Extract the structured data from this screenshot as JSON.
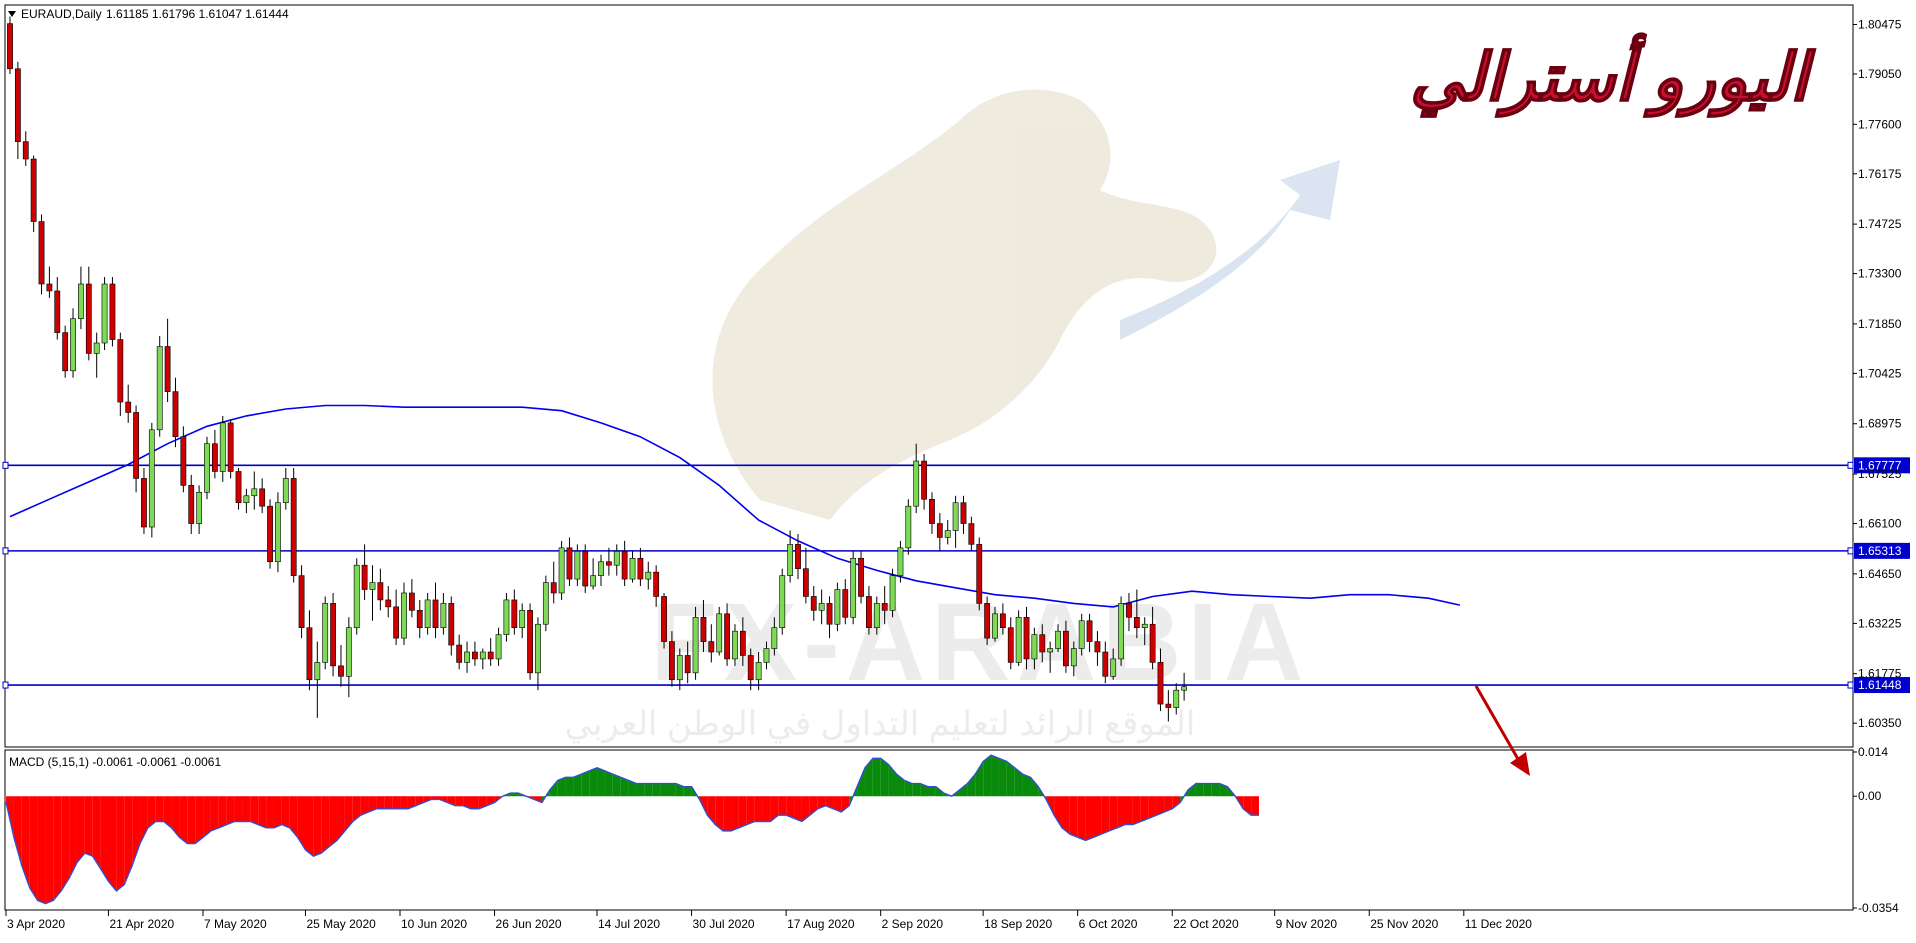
{
  "header": {
    "symbol": "EURAUD,Daily",
    "ohlc": "1.61185 1.61796 1.61047 1.61444"
  },
  "overlay_title": "اليورو أسترالي",
  "watermark": {
    "brand": "FX-ARABIA",
    "tagline": "الموقع الرائد لتعليم التداول في الوطن العربي"
  },
  "colors": {
    "bull_body": "#7ed957",
    "bear_body": "#cc0000",
    "wick": "#000000",
    "ma_line": "#0000ee",
    "level_line": "#0000cc",
    "macd_positive": "#0a8a0a",
    "macd_negative": "#ff0000",
    "macd_outline": "#3050d0",
    "arrow": "#c00000",
    "title_red": "#c8102e",
    "axis_text": "#000000"
  },
  "chart_data": [
    {
      "type": "candlestick",
      "symbol": "EURAUD",
      "timeframe": "Daily",
      "ylim": [
        1.5975,
        1.8095
      ],
      "y_ticks": [
        "1.80475",
        "1.79050",
        "1.77600",
        "1.76175",
        "1.74725",
        "1.73300",
        "1.71850",
        "1.70425",
        "1.68975",
        "1.67525",
        "1.66100",
        "1.64650",
        "1.63225",
        "1.61775",
        "1.60350"
      ],
      "x_ticks": [
        "3 Apr 2020",
        "21 Apr 2020",
        "7 May 2020",
        "25 May 2020",
        "10 Jun 2020",
        "26 Jun 2020",
        "14 Jul 2020",
        "30 Jul 2020",
        "17 Aug 2020",
        "2 Sep 2020",
        "18 Sep 2020",
        "6 Oct 2020",
        "22 Oct 2020",
        "9 Nov 2020",
        "25 Nov 2020",
        "11 Dec 2020"
      ],
      "x_tick_index": [
        0,
        13,
        25,
        38,
        50,
        62,
        75,
        87,
        99,
        111,
        124,
        136,
        148,
        161,
        173,
        185
      ],
      "horizontal_levels": [
        {
          "value": 1.67777,
          "label": "1.67777"
        },
        {
          "value": 1.65313,
          "label": "1.65313"
        },
        {
          "value": 1.61448,
          "label": "1.61448"
        }
      ],
      "ma_points": [
        [
          0,
          1.663
        ],
        [
          5,
          1.668
        ],
        [
          10,
          1.673
        ],
        [
          15,
          1.678
        ],
        [
          20,
          1.684
        ],
        [
          25,
          1.689
        ],
        [
          30,
          1.692
        ],
        [
          35,
          1.694
        ],
        [
          40,
          1.695
        ],
        [
          45,
          1.695
        ],
        [
          50,
          1.6945
        ],
        [
          55,
          1.6945
        ],
        [
          60,
          1.6945
        ],
        [
          65,
          1.6945
        ],
        [
          70,
          1.6935
        ],
        [
          75,
          1.69
        ],
        [
          80,
          1.686
        ],
        [
          85,
          1.68
        ],
        [
          90,
          1.672
        ],
        [
          95,
          1.662
        ],
        [
          100,
          1.656
        ],
        [
          105,
          1.651
        ],
        [
          110,
          1.6475
        ],
        [
          115,
          1.6445
        ],
        [
          120,
          1.6425
        ],
        [
          125,
          1.6405
        ],
        [
          130,
          1.6395
        ],
        [
          135,
          1.638
        ],
        [
          140,
          1.637
        ],
        [
          145,
          1.64
        ],
        [
          150,
          1.6415
        ],
        [
          155,
          1.6405
        ],
        [
          160,
          1.64
        ],
        [
          165,
          1.6395
        ],
        [
          170,
          1.6405
        ],
        [
          175,
          1.6405
        ],
        [
          180,
          1.6395
        ],
        [
          184,
          1.6375
        ]
      ],
      "candles_ohl_c": [
        [
          1.805,
          1.807,
          1.7905,
          1.792
        ],
        [
          1.792,
          1.794,
          1.766,
          1.771
        ],
        [
          1.771,
          1.774,
          1.764,
          1.766
        ],
        [
          1.766,
          1.767,
          1.745,
          1.748
        ],
        [
          1.748,
          1.75,
          1.727,
          1.73
        ],
        [
          1.73,
          1.735,
          1.726,
          1.728
        ],
        [
          1.728,
          1.732,
          1.714,
          1.716
        ],
        [
          1.716,
          1.718,
          1.703,
          1.705
        ],
        [
          1.705,
          1.723,
          1.703,
          1.72
        ],
        [
          1.72,
          1.735,
          1.717,
          1.73
        ],
        [
          1.73,
          1.735,
          1.708,
          1.71
        ],
        [
          1.71,
          1.716,
          1.703,
          1.713
        ],
        [
          1.713,
          1.732,
          1.711,
          1.73
        ],
        [
          1.73,
          1.732,
          1.712,
          1.714
        ],
        [
          1.714,
          1.716,
          1.692,
          1.696
        ],
        [
          1.696,
          1.701,
          1.69,
          1.693
        ],
        [
          1.693,
          1.695,
          1.67,
          1.674
        ],
        [
          1.674,
          1.677,
          1.658,
          1.66
        ],
        [
          1.66,
          1.69,
          1.657,
          1.688
        ],
        [
          1.688,
          1.715,
          1.686,
          1.712
        ],
        [
          1.712,
          1.72,
          1.696,
          1.699
        ],
        [
          1.699,
          1.703,
          1.683,
          1.686
        ],
        [
          1.686,
          1.689,
          1.67,
          1.672
        ],
        [
          1.672,
          1.675,
          1.658,
          1.661
        ],
        [
          1.661,
          1.672,
          1.658,
          1.67
        ],
        [
          1.67,
          1.686,
          1.668,
          1.684
        ],
        [
          1.684,
          1.688,
          1.674,
          1.676
        ],
        [
          1.676,
          1.692,
          1.673,
          1.69
        ],
        [
          1.69,
          1.691,
          1.674,
          1.676
        ],
        [
          1.676,
          1.677,
          1.665,
          1.667
        ],
        [
          1.667,
          1.671,
          1.664,
          1.669
        ],
        [
          1.669,
          1.676,
          1.665,
          1.671
        ],
        [
          1.671,
          1.674,
          1.664,
          1.666
        ],
        [
          1.666,
          1.668,
          1.648,
          1.65
        ],
        [
          1.65,
          1.67,
          1.647,
          1.667
        ],
        [
          1.667,
          1.677,
          1.665,
          1.674
        ],
        [
          1.674,
          1.677,
          1.644,
          1.646
        ],
        [
          1.646,
          1.649,
          1.628,
          1.631
        ],
        [
          1.631,
          1.636,
          1.613,
          1.616
        ],
        [
          1.616,
          1.627,
          1.605,
          1.621
        ],
        [
          1.621,
          1.64,
          1.619,
          1.638
        ],
        [
          1.638,
          1.641,
          1.617,
          1.62
        ],
        [
          1.62,
          1.626,
          1.614,
          1.617
        ],
        [
          1.617,
          1.634,
          1.611,
          1.631
        ],
        [
          1.631,
          1.651,
          1.629,
          1.649
        ],
        [
          1.649,
          1.655,
          1.639,
          1.642
        ],
        [
          1.642,
          1.649,
          1.633,
          1.644
        ],
        [
          1.644,
          1.648,
          1.636,
          1.639
        ],
        [
          1.639,
          1.643,
          1.634,
          1.637
        ],
        [
          1.637,
          1.642,
          1.626,
          1.628
        ],
        [
          1.628,
          1.644,
          1.626,
          1.641
        ],
        [
          1.641,
          1.645,
          1.634,
          1.636
        ],
        [
          1.636,
          1.639,
          1.628,
          1.631
        ],
        [
          1.631,
          1.641,
          1.629,
          1.639
        ],
        [
          1.639,
          1.644,
          1.628,
          1.631
        ],
        [
          1.631,
          1.641,
          1.629,
          1.638
        ],
        [
          1.638,
          1.64,
          1.623,
          1.626
        ],
        [
          1.626,
          1.629,
          1.619,
          1.621
        ],
        [
          1.621,
          1.627,
          1.618,
          1.624
        ],
        [
          1.624,
          1.627,
          1.62,
          1.622
        ],
        [
          1.622,
          1.625,
          1.619,
          1.624
        ],
        [
          1.624,
          1.628,
          1.62,
          1.622
        ],
        [
          1.622,
          1.631,
          1.62,
          1.629
        ],
        [
          1.629,
          1.641,
          1.627,
          1.639
        ],
        [
          1.639,
          1.642,
          1.629,
          1.631
        ],
        [
          1.631,
          1.638,
          1.628,
          1.636
        ],
        [
          1.636,
          1.638,
          1.616,
          1.618
        ],
        [
          1.618,
          1.634,
          1.613,
          1.632
        ],
        [
          1.632,
          1.646,
          1.63,
          1.644
        ],
        [
          1.644,
          1.65,
          1.638,
          1.641
        ],
        [
          1.641,
          1.656,
          1.639,
          1.654
        ],
        [
          1.654,
          1.657,
          1.643,
          1.645
        ],
        [
          1.645,
          1.655,
          1.643,
          1.653
        ],
        [
          1.653,
          1.655,
          1.641,
          1.643
        ],
        [
          1.643,
          1.651,
          1.642,
          1.646
        ],
        [
          1.646,
          1.652,
          1.643,
          1.65
        ],
        [
          1.65,
          1.654,
          1.646,
          1.649
        ],
        [
          1.649,
          1.655,
          1.646,
          1.653
        ],
        [
          1.653,
          1.656,
          1.643,
          1.645
        ],
        [
          1.645,
          1.653,
          1.644,
          1.651
        ],
        [
          1.651,
          1.654,
          1.643,
          1.645
        ],
        [
          1.645,
          1.65,
          1.642,
          1.647
        ],
        [
          1.647,
          1.649,
          1.637,
          1.64
        ],
        [
          1.64,
          1.641,
          1.625,
          1.627
        ],
        [
          1.627,
          1.63,
          1.614,
          1.616
        ],
        [
          1.616,
          1.625,
          1.613,
          1.623
        ],
        [
          1.623,
          1.627,
          1.615,
          1.618
        ],
        [
          1.618,
          1.637,
          1.616,
          1.634
        ],
        [
          1.634,
          1.639,
          1.624,
          1.627
        ],
        [
          1.627,
          1.632,
          1.621,
          1.624
        ],
        [
          1.624,
          1.637,
          1.623,
          1.635
        ],
        [
          1.635,
          1.638,
          1.62,
          1.622
        ],
        [
          1.622,
          1.632,
          1.62,
          1.63
        ],
        [
          1.63,
          1.634,
          1.62,
          1.623
        ],
        [
          1.623,
          1.625,
          1.613,
          1.616
        ],
        [
          1.616,
          1.624,
          1.613,
          1.621
        ],
        [
          1.621,
          1.627,
          1.619,
          1.625
        ],
        [
          1.625,
          1.634,
          1.623,
          1.631
        ],
        [
          1.631,
          1.648,
          1.629,
          1.646
        ],
        [
          1.646,
          1.659,
          1.644,
          1.655
        ],
        [
          1.655,
          1.658,
          1.645,
          1.648
        ],
        [
          1.648,
          1.654,
          1.638,
          1.64
        ],
        [
          1.64,
          1.643,
          1.633,
          1.636
        ],
        [
          1.636,
          1.642,
          1.632,
          1.638
        ],
        [
          1.638,
          1.64,
          1.628,
          1.632
        ],
        [
          1.632,
          1.644,
          1.63,
          1.642
        ],
        [
          1.642,
          1.645,
          1.632,
          1.634
        ],
        [
          1.634,
          1.653,
          1.632,
          1.651
        ],
        [
          1.651,
          1.653,
          1.638,
          1.64
        ],
        [
          1.64,
          1.643,
          1.629,
          1.631
        ],
        [
          1.631,
          1.64,
          1.629,
          1.638
        ],
        [
          1.638,
          1.643,
          1.632,
          1.636
        ],
        [
          1.636,
          1.648,
          1.634,
          1.646
        ],
        [
          1.646,
          1.656,
          1.644,
          1.654
        ],
        [
          1.654,
          1.668,
          1.652,
          1.666
        ],
        [
          1.666,
          1.684,
          1.664,
          1.679
        ],
        [
          1.679,
          1.681,
          1.665,
          1.668
        ],
        [
          1.668,
          1.67,
          1.658,
          1.661
        ],
        [
          1.661,
          1.664,
          1.653,
          1.657
        ],
        [
          1.657,
          1.662,
          1.655,
          1.659
        ],
        [
          1.659,
          1.669,
          1.654,
          1.667
        ],
        [
          1.667,
          1.669,
          1.658,
          1.661
        ],
        [
          1.661,
          1.663,
          1.653,
          1.655
        ],
        [
          1.655,
          1.657,
          1.636,
          1.638
        ],
        [
          1.638,
          1.64,
          1.626,
          1.628
        ],
        [
          1.628,
          1.637,
          1.627,
          1.635
        ],
        [
          1.635,
          1.638,
          1.629,
          1.631
        ],
        [
          1.631,
          1.634,
          1.619,
          1.621
        ],
        [
          1.621,
          1.636,
          1.62,
          1.634
        ],
        [
          1.634,
          1.637,
          1.619,
          1.622
        ],
        [
          1.622,
          1.631,
          1.619,
          1.629
        ],
        [
          1.629,
          1.632,
          1.621,
          1.624
        ],
        [
          1.624,
          1.627,
          1.618,
          1.625
        ],
        [
          1.625,
          1.632,
          1.624,
          1.63
        ],
        [
          1.63,
          1.633,
          1.618,
          1.62
        ],
        [
          1.62,
          1.627,
          1.617,
          1.625
        ],
        [
          1.625,
          1.635,
          1.623,
          1.633
        ],
        [
          1.633,
          1.635,
          1.624,
          1.627
        ],
        [
          1.627,
          1.63,
          1.62,
          1.624
        ],
        [
          1.624,
          1.627,
          1.615,
          1.617
        ],
        [
          1.617,
          1.625,
          1.616,
          1.622
        ],
        [
          1.622,
          1.64,
          1.62,
          1.638
        ],
        [
          1.638,
          1.641,
          1.63,
          1.634
        ],
        [
          1.634,
          1.642,
          1.628,
          1.631
        ],
        [
          1.631,
          1.634,
          1.626,
          1.632
        ],
        [
          1.632,
          1.637,
          1.619,
          1.621
        ],
        [
          1.621,
          1.625,
          1.607,
          1.609
        ],
        [
          1.609,
          1.613,
          1.604,
          1.608
        ],
        [
          1.608,
          1.615,
          1.606,
          1.613
        ],
        [
          1.613,
          1.618,
          1.61,
          1.614
        ]
      ],
      "macd_label": "MACD (5,15,1) -0.0061 -0.0061 -0.0061",
      "macd_ylim": [
        -0.0354,
        0.014
      ],
      "macd_ticks": [
        "0.014",
        "0.00",
        "-0.0354"
      ],
      "macd_values": [
        -0.002,
        -0.013,
        -0.022,
        -0.029,
        -0.033,
        -0.034,
        -0.033,
        -0.03,
        -0.026,
        -0.021,
        -0.018,
        -0.019,
        -0.023,
        -0.027,
        -0.03,
        -0.028,
        -0.022,
        -0.015,
        -0.01,
        -0.008,
        -0.008,
        -0.01,
        -0.013,
        -0.015,
        -0.015,
        -0.013,
        -0.011,
        -0.01,
        -0.009,
        -0.008,
        -0.008,
        -0.008,
        -0.009,
        -0.01,
        -0.01,
        -0.009,
        -0.01,
        -0.013,
        -0.017,
        -0.019,
        -0.018,
        -0.016,
        -0.014,
        -0.011,
        -0.008,
        -0.006,
        -0.005,
        -0.004,
        -0.004,
        -0.004,
        -0.004,
        -0.004,
        -0.003,
        -0.002,
        -0.001,
        -0.001,
        -0.002,
        -0.003,
        -0.003,
        -0.004,
        -0.004,
        -0.003,
        -0.002,
        0.0,
        0.001,
        0.001,
        0.0,
        -0.001,
        -0.002,
        0.002,
        0.005,
        0.006,
        0.006,
        0.007,
        0.008,
        0.009,
        0.008,
        0.007,
        0.006,
        0.005,
        0.004,
        0.004,
        0.004,
        0.004,
        0.004,
        0.004,
        0.003,
        0.003,
        -0.001,
        -0.006,
        -0.009,
        -0.011,
        -0.011,
        -0.01,
        -0.009,
        -0.008,
        -0.008,
        -0.008,
        -0.006,
        -0.006,
        -0.007,
        -0.008,
        -0.006,
        -0.004,
        -0.003,
        -0.004,
        -0.005,
        -0.003,
        0.003,
        0.009,
        0.012,
        0.012,
        0.01,
        0.007,
        0.005,
        0.004,
        0.004,
        0.003,
        0.003,
        0.001,
        0.0,
        0.002,
        0.004,
        0.007,
        0.011,
        0.013,
        0.012,
        0.011,
        0.009,
        0.007,
        0.006,
        0.003,
        -0.001,
        -0.006,
        -0.01,
        -0.012,
        -0.013,
        -0.014,
        -0.013,
        -0.012,
        -0.011,
        -0.01,
        -0.009,
        -0.009,
        -0.008,
        -0.007,
        -0.006,
        -0.005,
        -0.004,
        -0.002,
        0.002,
        0.004,
        0.004,
        0.004,
        0.004,
        0.003,
        0.0,
        -0.004,
        -0.006,
        -0.006
      ]
    }
  ]
}
